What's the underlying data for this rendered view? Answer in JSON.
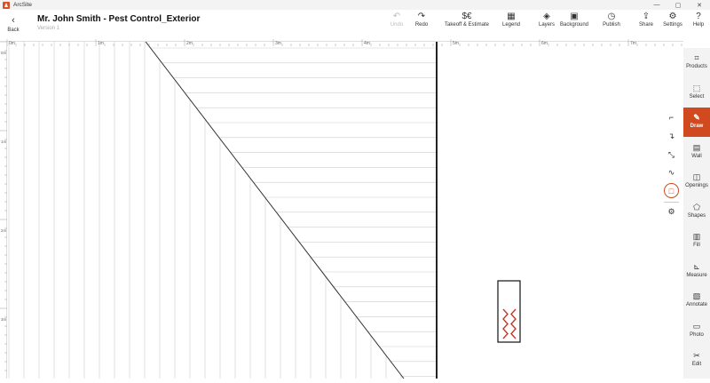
{
  "app": {
    "name": "ArcSite"
  },
  "window_controls": {
    "minimize": "—",
    "maximize": "▢",
    "close": "✕"
  },
  "header": {
    "back_icon": "‹",
    "back_label": "Back",
    "title": "Mr. John Smith - Pest Control_Exterior",
    "version": "Version 1"
  },
  "toolbar": [
    {
      "id": "undo",
      "label": "Undo",
      "icon": "↶",
      "icon_name": "undo-icon",
      "disabled": true
    },
    {
      "id": "redo",
      "label": "Redo",
      "icon": "↷",
      "icon_name": "redo-icon",
      "disabled": false
    },
    {
      "id": "takeoff",
      "label": "Takeoff & Estimate",
      "icon": "$€",
      "icon_name": "takeoff-estimate-icon",
      "disabled": false
    },
    {
      "id": "legend",
      "label": "Legend",
      "icon": "▦",
      "icon_name": "legend-icon",
      "disabled": false
    },
    {
      "id": "layers",
      "label": "Layers",
      "icon": "◈",
      "icon_name": "layers-icon",
      "disabled": false
    },
    {
      "id": "background",
      "label": "Background",
      "icon": "▣",
      "icon_name": "background-icon",
      "disabled": false
    },
    {
      "id": "publish",
      "label": "Publish",
      "icon": "◷",
      "icon_name": "publish-icon",
      "disabled": false
    },
    {
      "id": "share",
      "label": "Share",
      "icon": "⇪",
      "icon_name": "share-icon",
      "disabled": false
    },
    {
      "id": "settings",
      "label": "Settings",
      "icon": "⚙",
      "icon_name": "gear-icon",
      "disabled": false
    },
    {
      "id": "help",
      "label": "Help",
      "icon": "?",
      "icon_name": "help-icon",
      "disabled": false
    }
  ],
  "ruler": {
    "top_labels": [
      "0m",
      "1m",
      "2m",
      "3m",
      "4m",
      "5m",
      "6m",
      "7m"
    ],
    "left_labels": [
      "0m",
      "1m",
      "2m",
      "3m"
    ]
  },
  "draw_tools": [
    {
      "icon": "⌐",
      "icon_name": "line-corner-icon",
      "selected": false
    },
    {
      "icon": "↴",
      "icon_name": "polyline-icon",
      "selected": false
    },
    {
      "icon": "⤡",
      "icon_name": "dimension-line-icon",
      "selected": false
    },
    {
      "icon": "∿",
      "icon_name": "curve-icon",
      "selected": false
    },
    {
      "icon": "□",
      "icon_name": "rectangle-icon",
      "selected": true
    },
    {
      "icon": "⚙",
      "icon_name": "draw-settings-icon",
      "selected": false
    }
  ],
  "right_panel": [
    {
      "label": "Products",
      "icon": "⌗",
      "icon_name": "products-icon",
      "active": false
    },
    {
      "label": "Select",
      "icon": "⬚",
      "icon_name": "select-icon",
      "active": false
    },
    {
      "label": "Draw",
      "icon": "✎",
      "icon_name": "draw-icon",
      "active": true
    },
    {
      "label": "Wall",
      "icon": "▤",
      "icon_name": "wall-icon",
      "active": false
    },
    {
      "label": "Openings",
      "icon": "◫",
      "icon_name": "openings-icon",
      "active": false
    },
    {
      "label": "Shapes",
      "icon": "⬠",
      "icon_name": "shapes-icon",
      "active": false
    },
    {
      "label": "Fill",
      "icon": "▥",
      "icon_name": "fill-icon",
      "active": false
    },
    {
      "label": "Measure",
      "icon": "⊾",
      "icon_name": "measure-icon",
      "active": false
    },
    {
      "label": "Annotate",
      "icon": "▧",
      "icon_name": "annotate-icon",
      "active": false
    },
    {
      "label": "Photo",
      "icon": "▭",
      "icon_name": "photo-icon",
      "active": false
    },
    {
      "label": "Edit",
      "icon": "✂",
      "icon_name": "edit-icon",
      "active": false
    }
  ],
  "colors": {
    "accent": "#d0491f",
    "panel_bg": "#f3f3f3",
    "grid_line": "#cfcfcf",
    "drawing_line": "#333333"
  }
}
